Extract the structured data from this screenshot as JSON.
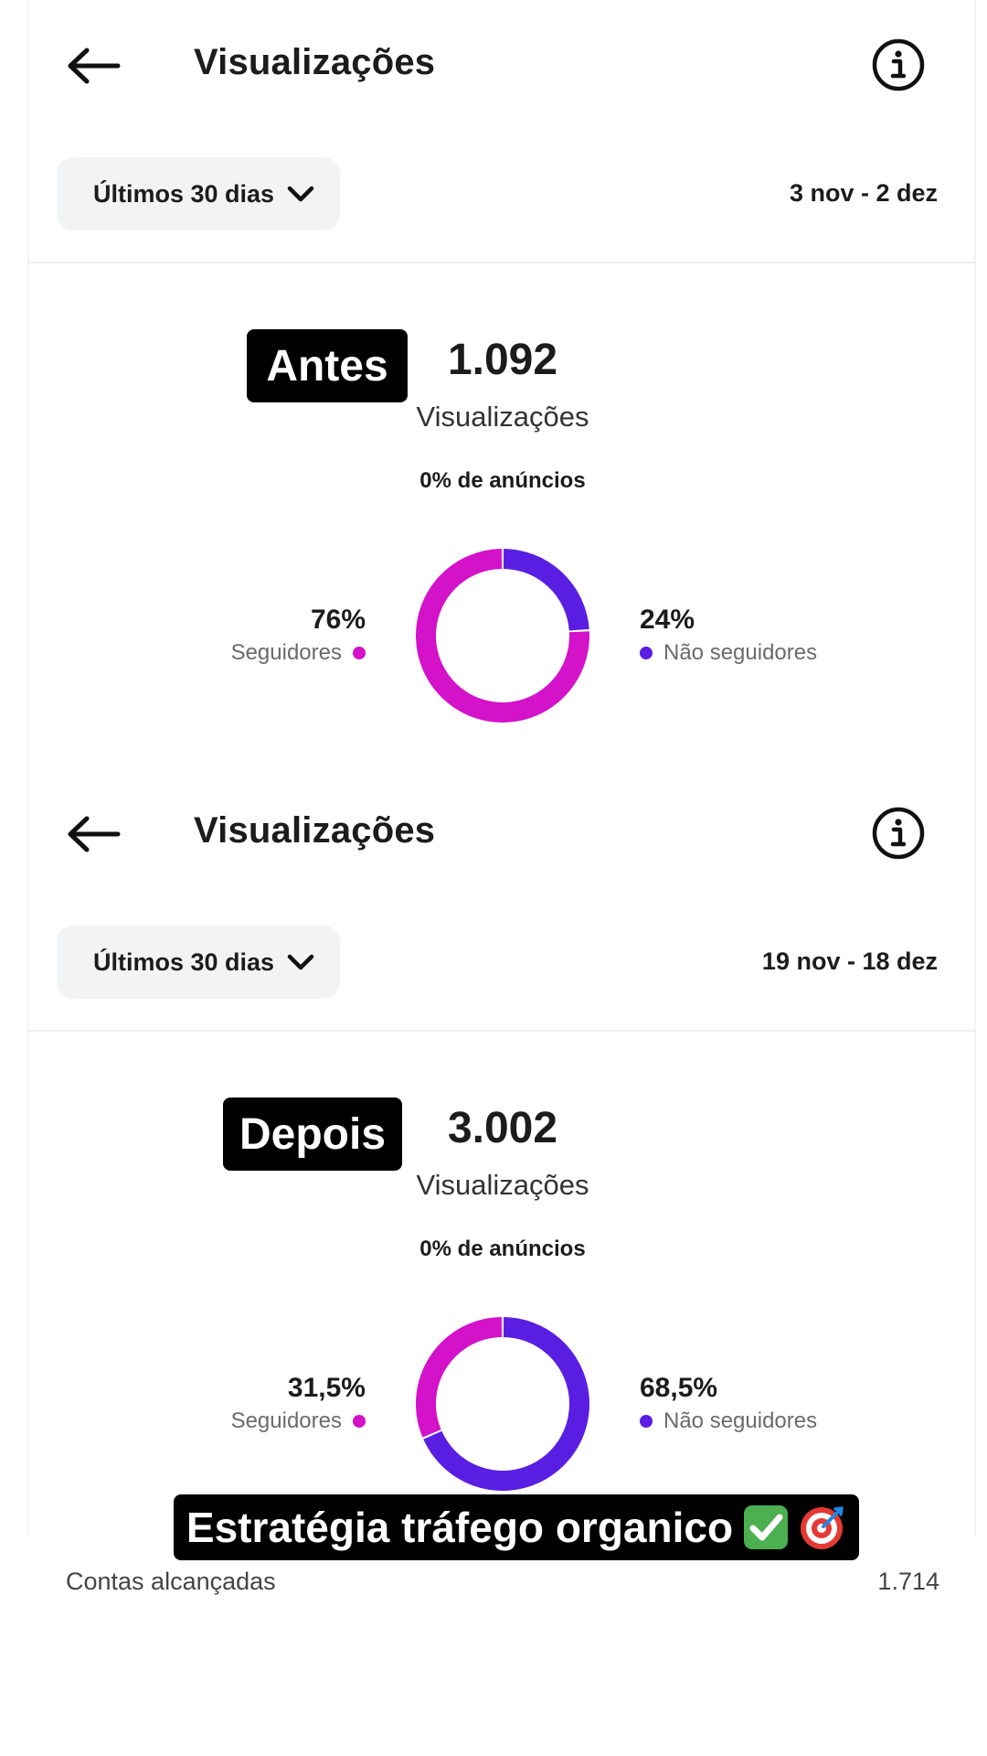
{
  "colors": {
    "followers": "#d312c9",
    "non_followers": "#5a1ee3",
    "dropdown_bg": "#f2f3f5",
    "tag_bg": "#000000"
  },
  "before": {
    "title": "Visualizações",
    "range_label": "Últimos 30 dias",
    "date_range": "3 nov - 2 dez",
    "tag": "Antes",
    "metric_value": "1.092",
    "metric_label": "Visualizações",
    "ads_share": "0% de anúncios",
    "followers_pct": "76%",
    "followers_label": "Seguidores",
    "non_followers_pct": "24%",
    "non_followers_label": "Não seguidores",
    "chart_data": {
      "type": "pie",
      "labels": [
        "Seguidores",
        "Não seguidores"
      ],
      "values": [
        76,
        24
      ]
    }
  },
  "after": {
    "title": "Visualizações",
    "range_label": "Últimos 30 dias",
    "date_range": "19 nov - 18 dez",
    "tag": "Depois",
    "metric_value": "3.002",
    "metric_label": "Visualizações",
    "ads_share": "0% de anúncios",
    "followers_pct": "31,5%",
    "followers_label": "Seguidores",
    "non_followers_pct": "68,5%",
    "non_followers_label": "Não seguidores",
    "chart_data": {
      "type": "pie",
      "labels": [
        "Seguidores",
        "Não seguidores"
      ],
      "values": [
        31.5,
        68.5
      ]
    }
  },
  "caption": {
    "text": "Estratégia tráfego organico",
    "emoji_icons": [
      "check-mark-icon",
      "target-icon"
    ]
  },
  "reach": {
    "label": "Contas alcançadas",
    "value": "1.714"
  },
  "icons": {
    "back": "arrow-left-icon",
    "info": "info-icon",
    "dropdown": "chevron-down-icon"
  }
}
